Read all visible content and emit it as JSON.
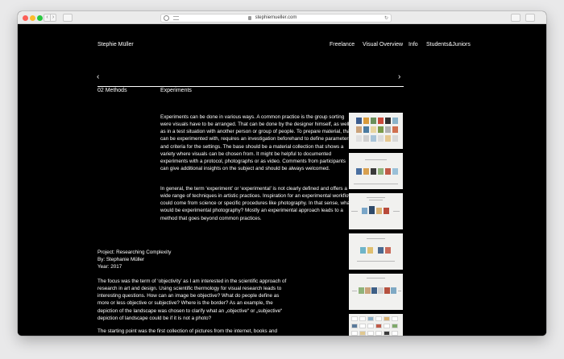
{
  "browser": {
    "url": "stephiemueller.com"
  },
  "site": {
    "name": "Stephie Müller",
    "nav": [
      "Freelance",
      "Visual Overview",
      "Info",
      "Students&Juniors"
    ]
  },
  "section": {
    "number": "02  Methods",
    "title": "Experiments",
    "prev_icon": "chevron-left-icon",
    "next_icon": "chevron-right-icon"
  },
  "content": {
    "paragraph1": "Experiments can be done in various ways. A common practice is the group sorting were visuals have to be arranged. That can be done by the designer himself, as well as in a test situation with another person or group of people. To prepare material, that can be experimented with, requires an investigation beforehand to define parameters and criteria for the settings. The base should be a material collection that shows a variety where visuals can be chosen from. It might be helpful to documented experiments with a protocol, photographs or as video. Comments from participants can give additional insights on the subject and should be always welcomed.",
    "paragraph2": "In general, the term ‘experiment’ or ‘experimental’ is not clearly defined and offers a wide range of techniques in artistic practices. Inspiration for an experimental workflow could come from science or specific procedures like photography. In that sense, what would be experimental photography? Mostly an experimental approach leads to a method that goes beyond common practices.",
    "project_line1": "Project: Researching Complexity",
    "project_line2": "By: Stephanie Müller",
    "project_line3": "Year: 2017",
    "paragraph3": "The focus was the term of ‘objectivity’ as I am interested in the scientific approach of research in art and design. Using scientific thermology for visual research leads to interesting questions. How can an image be objective? What do people define as more or less objective or subjective? Where is the border? As an example, the depiction of the landscape was chosen to clarify what an „objective“ or „subjective“ depiction of landscape could be if it is not a photo?",
    "paragraph4": "The starting point was the first collection of pictures from the internet, books and magazines of different types such as maps, fictional illustrations, visual analysis of environment or infographics."
  },
  "thumbnails": [
    {
      "name": "experiment-grid-photo"
    },
    {
      "name": "experiment-row-photo"
    },
    {
      "name": "experiment-spectrum-photo"
    },
    {
      "name": "experiment-pairs-photo"
    },
    {
      "name": "experiment-scale-photo"
    },
    {
      "name": "experiment-collection-photo"
    }
  ],
  "colors": {
    "page_background": "#000000",
    "text": "#ffffff",
    "thumbnail_background": "#f1f1ef"
  }
}
